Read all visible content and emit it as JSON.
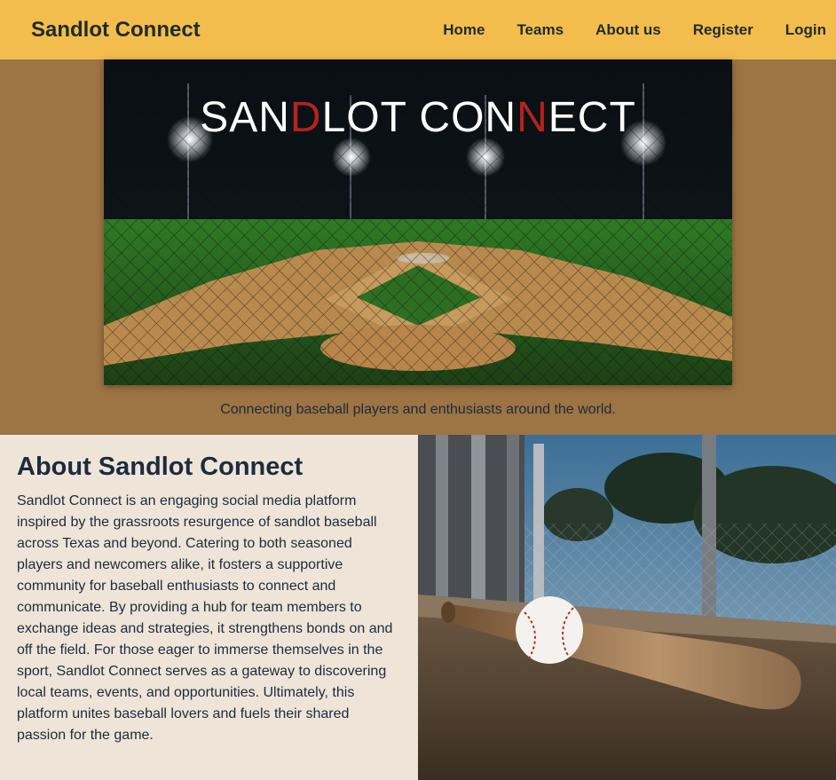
{
  "header": {
    "brand": "Sandlot Connect",
    "nav": [
      "Home",
      "Teams",
      "About us",
      "Register",
      "Login"
    ]
  },
  "hero": {
    "logo": {
      "s": "SAN",
      "d": "D",
      "lot": "LOT ",
      "con": "CON",
      "n": "N",
      "ect": "ECT"
    },
    "tagline": "Connecting baseball players and enthusiasts around the world."
  },
  "about": {
    "title": "About Sandlot Connect",
    "body": "Sandlot Connect is an engaging social media platform inspired by the grassroots resurgence of sandlot baseball across Texas and beyond. Catering to both seasoned players and newcomers alike, it fosters a supportive community for baseball enthusiasts to connect and communicate. By providing a hub for team members to exchange ideas and strategies, it strengthens bonds on and off the field. For those eager to immerse themselves in the sport, Sandlot Connect serves as a gateway to discovering local teams, events, and opportunities. Ultimately, this platform unites baseball lovers and fuels their shared passion for the game."
  },
  "colors": {
    "header_bg": "#f3bd4d",
    "hero_bg": "#9d7444",
    "about_bg": "#efe4d8",
    "logo_accent": "#b3231d",
    "text_dark": "#1b2c3e"
  }
}
